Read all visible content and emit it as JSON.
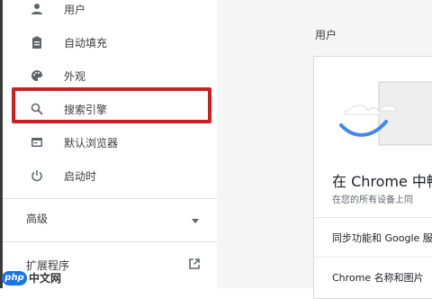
{
  "sidebar": {
    "items": [
      {
        "label": "用户",
        "icon": "person-icon"
      },
      {
        "label": "自动填充",
        "icon": "clipboard-icon"
      },
      {
        "label": "外观",
        "icon": "palette-icon"
      },
      {
        "label": "搜索引擎",
        "icon": "search-icon"
      },
      {
        "label": "默认浏览器",
        "icon": "browser-icon"
      },
      {
        "label": "启动时",
        "icon": "power-icon"
      }
    ],
    "advanced_label": "高级",
    "extensions_label": "扩展程序"
  },
  "main": {
    "section_title": "用户",
    "card": {
      "title": "在 Chrome 中畅",
      "subtitle": "在您的所有设备上同",
      "row1": "同步功能和 Google 服",
      "row2": "Chrome 名称和图片"
    }
  },
  "watermark": {
    "logo": "php",
    "text": "中文网"
  },
  "colors": {
    "highlight": "#cc2020",
    "accent": "#4285f4",
    "icon": "#5f6368"
  }
}
